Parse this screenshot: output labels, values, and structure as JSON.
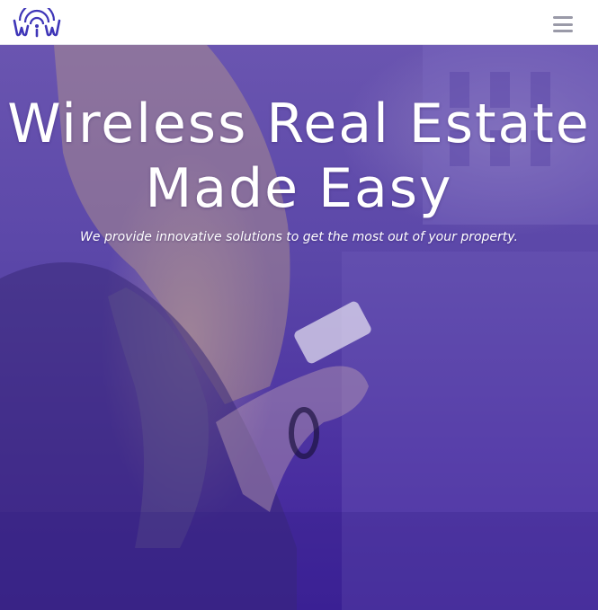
{
  "header": {
    "logo_icon": "wiw-wifi-logo",
    "menu_icon": "hamburger-menu-icon"
  },
  "hero": {
    "title_line1": "Wireless Real Estate",
    "title_line2": "Made Easy",
    "subtitle": "We provide innovative solutions to get the most out of your property.",
    "overlay_color": "#4b2fa3"
  },
  "colors": {
    "brand": "#3f36b8",
    "menu_icon": "#9a9aa8"
  }
}
